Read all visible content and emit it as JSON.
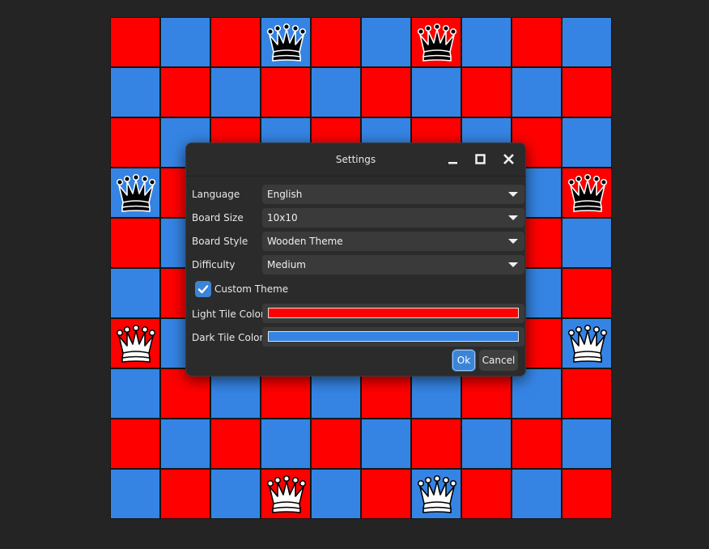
{
  "board": {
    "size": 10,
    "light_color": "#3584e4",
    "dark_color": "#ff0000",
    "pieces": [
      {
        "row": 0,
        "col": 3,
        "color": "black",
        "type": "queen-icon"
      },
      {
        "row": 0,
        "col": 6,
        "color": "black",
        "type": "queen-icon"
      },
      {
        "row": 3,
        "col": 0,
        "color": "black",
        "type": "queen-icon"
      },
      {
        "row": 3,
        "col": 9,
        "color": "black",
        "type": "queen-icon"
      },
      {
        "row": 6,
        "col": 0,
        "color": "white",
        "type": "queen-icon"
      },
      {
        "row": 6,
        "col": 9,
        "color": "white",
        "type": "queen-icon"
      },
      {
        "row": 9,
        "col": 3,
        "color": "white",
        "type": "queen-icon"
      },
      {
        "row": 9,
        "col": 6,
        "color": "white",
        "type": "queen-icon"
      }
    ]
  },
  "dialog": {
    "title": "Settings",
    "language": {
      "label": "Language",
      "value": "English"
    },
    "board_size": {
      "label": "Board Size",
      "value": "10x10"
    },
    "board_style": {
      "label": "Board Style",
      "value": "Wooden Theme"
    },
    "difficulty": {
      "label": "Difficulty",
      "value": "Medium"
    },
    "custom_theme": {
      "label": "Custom Theme",
      "checked": true
    },
    "light_tile": {
      "label": "Light Tile Color",
      "color": "#ff0000"
    },
    "dark_tile": {
      "label": "Dark Tile Color",
      "color": "#3584e4"
    },
    "ok_label": "Ok",
    "cancel_label": "Cancel"
  }
}
